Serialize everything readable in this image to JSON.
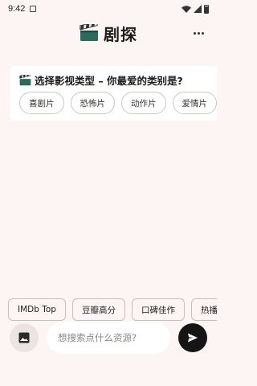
{
  "status_bar": {
    "time": "9:42"
  },
  "header": {
    "title": "剧探",
    "logo_icon": "clapperboard-icon",
    "more_icon": "more-vert-icon"
  },
  "genre_card": {
    "title": "选择影视类型 – 你最爱的类别是?",
    "title_icon": "clapperboard-icon",
    "options": [
      "喜剧片",
      "恐怖片",
      "动作片",
      "爱情片"
    ]
  },
  "quick_actions": [
    "IMDb Top",
    "豆瓣高分",
    "口碑佳作",
    "热播剧"
  ],
  "input_bar": {
    "image_icon": "image-icon",
    "placeholder": "想搜索点什么资源?",
    "send_icon": "send-icon"
  },
  "colors": {
    "background": "#fcf5f3",
    "card": "#ffffff",
    "send_button": "#151515"
  }
}
